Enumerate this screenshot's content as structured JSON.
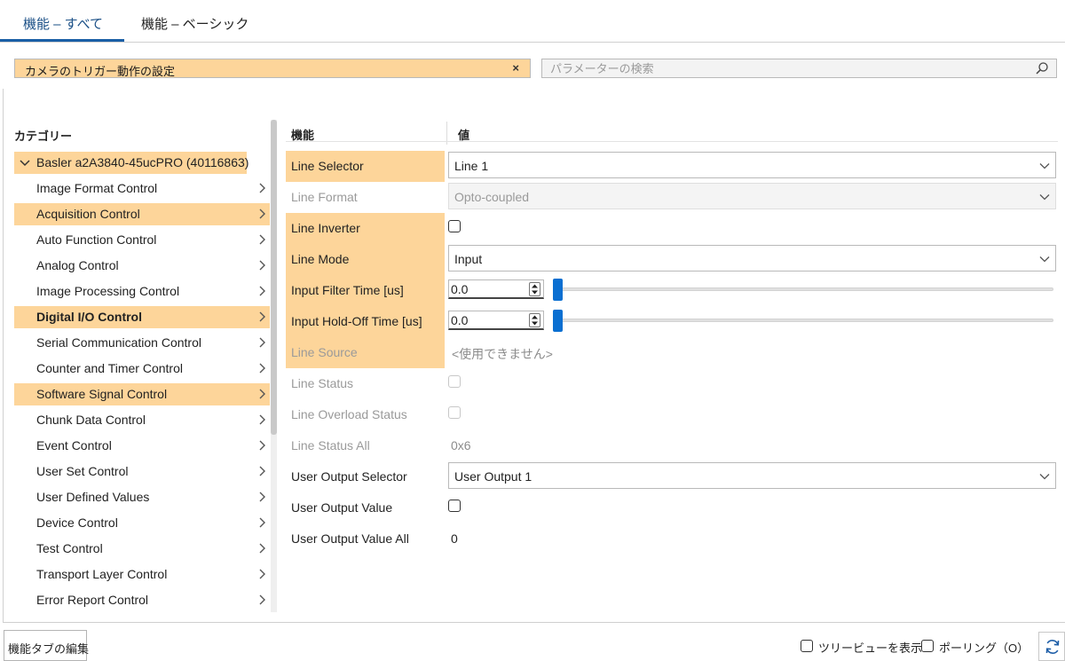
{
  "tabs": [
    {
      "label": "機能 – すべて",
      "active": true
    },
    {
      "label": "機能 – ベーシック",
      "active": false
    }
  ],
  "filter": {
    "value": "カメラのトリガー動作の設定",
    "clear": "×"
  },
  "search": {
    "placeholder": "パラメーターの検索"
  },
  "categories": {
    "header": "カテゴリー",
    "root": "Basler a2A3840-45ucPRO (40116863)",
    "items": [
      {
        "label": "Image Format Control",
        "highlighted": false,
        "bold": false
      },
      {
        "label": "Acquisition Control",
        "highlighted": true,
        "bold": false
      },
      {
        "label": "Auto Function Control",
        "highlighted": false,
        "bold": false
      },
      {
        "label": "Analog Control",
        "highlighted": false,
        "bold": false
      },
      {
        "label": "Image Processing Control",
        "highlighted": false,
        "bold": false
      },
      {
        "label": "Digital I/O Control",
        "highlighted": true,
        "bold": true
      },
      {
        "label": "Serial Communication Control",
        "highlighted": false,
        "bold": false
      },
      {
        "label": "Counter and Timer Control",
        "highlighted": false,
        "bold": false
      },
      {
        "label": "Software Signal Control",
        "highlighted": true,
        "bold": false
      },
      {
        "label": "Chunk Data Control",
        "highlighted": false,
        "bold": false
      },
      {
        "label": "Event Control",
        "highlighted": false,
        "bold": false
      },
      {
        "label": "User Set Control",
        "highlighted": false,
        "bold": false
      },
      {
        "label": "User Defined Values",
        "highlighted": false,
        "bold": false
      },
      {
        "label": "Device Control",
        "highlighted": false,
        "bold": false
      },
      {
        "label": "Test Control",
        "highlighted": false,
        "bold": false
      },
      {
        "label": "Transport Layer Control",
        "highlighted": false,
        "bold": false
      },
      {
        "label": "Error Report Control",
        "highlighted": false,
        "bold": false
      }
    ]
  },
  "features": {
    "header_name": "機能",
    "header_value": "値",
    "rows": [
      {
        "name": "Line Selector",
        "type": "combo",
        "value": "Line 1",
        "enabled": true,
        "highlighted": true
      },
      {
        "name": "Line Format",
        "type": "combo",
        "value": "Opto-coupled",
        "enabled": false,
        "highlighted": false
      },
      {
        "name": "Line Inverter",
        "type": "checkbox",
        "checked": false,
        "enabled": true,
        "highlighted": true
      },
      {
        "name": "Line Mode",
        "type": "combo",
        "value": "Input",
        "enabled": true,
        "highlighted": true
      },
      {
        "name": "Input Filter Time [us]",
        "type": "number",
        "value": "0.0",
        "enabled": true,
        "highlighted": true
      },
      {
        "name": "Input Hold-Off Time [us]",
        "type": "number",
        "value": "0.0",
        "enabled": true,
        "highlighted": true
      },
      {
        "name": "Line Source",
        "type": "text",
        "value": "<使用できません>",
        "enabled": false,
        "highlighted": true
      },
      {
        "name": "Line Status",
        "type": "checkbox",
        "checked": false,
        "enabled": false,
        "highlighted": false
      },
      {
        "name": "Line Overload Status",
        "type": "checkbox",
        "checked": false,
        "enabled": false,
        "highlighted": false
      },
      {
        "name": "Line Status All",
        "type": "text",
        "value": "0x6",
        "enabled": false,
        "highlighted": false
      },
      {
        "name": "User Output Selector",
        "type": "combo",
        "value": "User Output 1",
        "enabled": true,
        "highlighted": false
      },
      {
        "name": "User Output Value",
        "type": "checkbox",
        "checked": false,
        "enabled": true,
        "highlighted": false
      },
      {
        "name": "User Output Value All",
        "type": "text",
        "value": "0",
        "enabled": true,
        "highlighted": false
      }
    ]
  },
  "footer": {
    "edit_tabs_button": "機能タブの編集",
    "tree_view_option": "ツリービューを表示",
    "polling_option": "ポーリング（O）"
  },
  "colors": {
    "highlight": "#fdd59a",
    "accent": "#0a6fd1"
  }
}
